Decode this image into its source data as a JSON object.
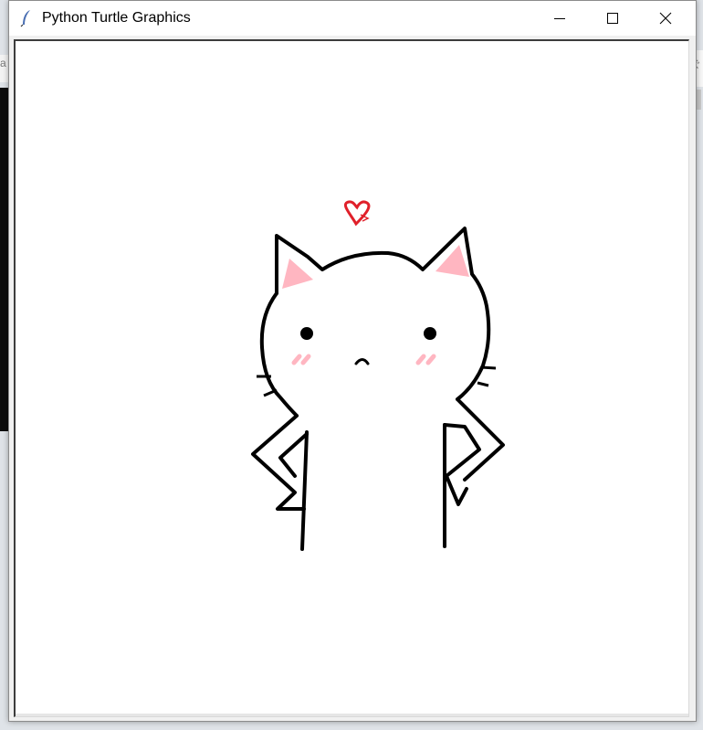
{
  "window": {
    "title": "Python Turtle Graphics",
    "icon": "feather-icon"
  },
  "controls": {
    "minimize": "minimize-icon",
    "maximize": "maximize-icon",
    "close": "close-icon"
  },
  "colors": {
    "titlebar": "#ffffff",
    "canvas": "#ffffff",
    "stroke": "#000000",
    "ear_inner": "#ffb6c1",
    "blush": "#ffb6c1",
    "heart": "#e0202a"
  },
  "background": {
    "left_fragment": "a",
    "right_fragment": "ぐ"
  }
}
